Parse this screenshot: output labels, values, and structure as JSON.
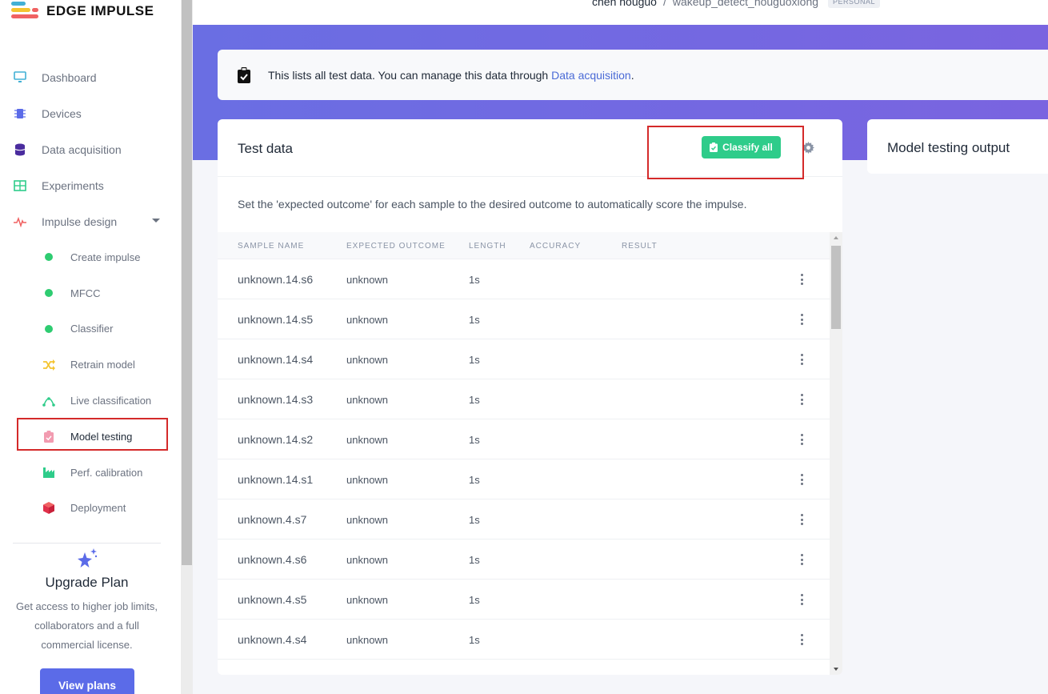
{
  "brand": {
    "name": "EDGE IMPULSE",
    "colors": {
      "accent": "#5b6be8",
      "success": "#2ecc8a",
      "highlight": "#d42a2a"
    }
  },
  "sidebar": {
    "items": [
      {
        "label": "Dashboard",
        "icon": "monitor-icon"
      },
      {
        "label": "Devices",
        "icon": "chip-icon"
      },
      {
        "label": "Data acquisition",
        "icon": "database-icon"
      },
      {
        "label": "Experiments",
        "icon": "table-icon"
      },
      {
        "label": "Impulse design",
        "icon": "pulse-icon"
      }
    ],
    "subitems": [
      {
        "label": "Create impulse",
        "icon": "dot-icon"
      },
      {
        "label": "MFCC",
        "icon": "dot-icon"
      },
      {
        "label": "Classifier",
        "icon": "dot-icon"
      },
      {
        "label": "Retrain model",
        "icon": "shuffle-icon"
      },
      {
        "label": "Live classification",
        "icon": "curve-icon"
      },
      {
        "label": "Model testing",
        "icon": "clipboard-icon"
      },
      {
        "label": "Perf. calibration",
        "icon": "factory-icon"
      },
      {
        "label": "Deployment",
        "icon": "cube-icon"
      }
    ]
  },
  "upgrade": {
    "title": "Upgrade Plan",
    "description": "Get access to higher job limits, collaborators and a full commercial license.",
    "button": "View plans"
  },
  "header": {
    "user": "chen houguo",
    "separator": "/",
    "project": "wakeup_detect_houguoxiong",
    "badge": "PERSONAL"
  },
  "info": {
    "text": "This lists all test data. You can manage this data through ",
    "link": "Data acquisition",
    "suffix": "."
  },
  "test_data": {
    "title": "Test data",
    "classify_button": "Classify all",
    "description": "Set the 'expected outcome' for each sample to the desired outcome to automatically score the impulse.",
    "columns": [
      "SAMPLE NAME",
      "EXPECTED OUTCOME",
      "LENGTH",
      "ACCURACY",
      "RESULT"
    ],
    "rows": [
      {
        "name": "unknown.14.s6",
        "expected": "unknown",
        "length": "1s"
      },
      {
        "name": "unknown.14.s5",
        "expected": "unknown",
        "length": "1s"
      },
      {
        "name": "unknown.14.s4",
        "expected": "unknown",
        "length": "1s"
      },
      {
        "name": "unknown.14.s3",
        "expected": "unknown",
        "length": "1s"
      },
      {
        "name": "unknown.14.s2",
        "expected": "unknown",
        "length": "1s"
      },
      {
        "name": "unknown.14.s1",
        "expected": "unknown",
        "length": "1s"
      },
      {
        "name": "unknown.4.s7",
        "expected": "unknown",
        "length": "1s"
      },
      {
        "name": "unknown.4.s6",
        "expected": "unknown",
        "length": "1s"
      },
      {
        "name": "unknown.4.s5",
        "expected": "unknown",
        "length": "1s"
      },
      {
        "name": "unknown.4.s4",
        "expected": "unknown",
        "length": "1s"
      }
    ]
  },
  "output": {
    "title": "Model testing output"
  }
}
